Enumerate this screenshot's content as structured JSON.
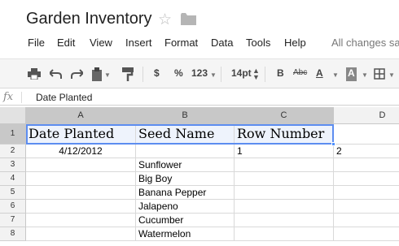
{
  "document": {
    "title": "Garden Inventory",
    "star_icon": "star-icon",
    "folder_icon": "folder-icon"
  },
  "menu": [
    "File",
    "Edit",
    "View",
    "Insert",
    "Format",
    "Data",
    "Tools",
    "Help"
  ],
  "status": "All changes sa",
  "toolbar": {
    "currency": "$",
    "percent": "%",
    "number_format": "123",
    "font_size": "14pt",
    "bold": "B",
    "strike": "Abc",
    "text_color": "A",
    "fill_color": "A"
  },
  "formula_bar": {
    "label": "fx",
    "value": "Date Planted"
  },
  "columns": [
    "A",
    "B",
    "C",
    "D"
  ],
  "rows": [
    "1",
    "2",
    "3",
    "4",
    "5",
    "6",
    "7",
    "8"
  ],
  "cells": {
    "A1": "Date Planted",
    "B1": "Seed Name",
    "C1": "Row Number",
    "A2": "4/12/2012",
    "C2": "1",
    "D2": "2",
    "B3": "Sunflower",
    "B4": "Big Boy",
    "B5": "Banana Pepper",
    "B6": "Jalapeno",
    "B7": "Cucumber",
    "B8": "Watermelon"
  },
  "colors": {
    "selection": "#5d8df0",
    "selected_header": "#c8c8c8",
    "selection_fill": "#eef3fc"
  }
}
